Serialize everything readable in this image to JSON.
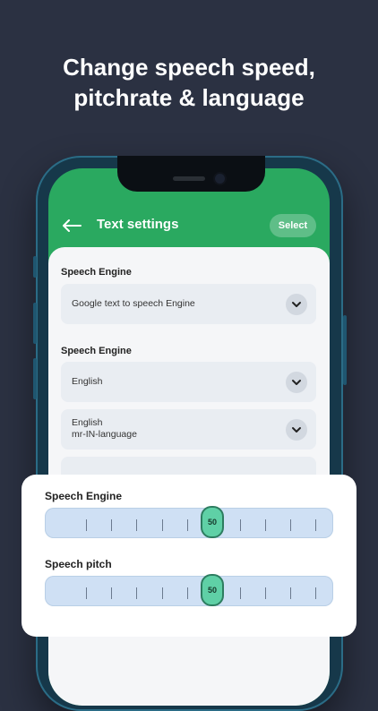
{
  "headline": {
    "line1": "Change speech speed,",
    "line2": "pitchrate & language"
  },
  "app": {
    "title": "Text settings",
    "select_label": "Select",
    "accent_color": "#2aa960",
    "back_icon": "arrow-left-icon"
  },
  "settings": {
    "section1_label": "Speech Engine",
    "engine_value": "Google text to speech Engine",
    "section2_label": "Speech Engine",
    "language_value": "English",
    "voice_value_line1": "English",
    "voice_value_line2": "mr-IN-language"
  },
  "card": {
    "rate_label": "Speech Engine",
    "rate_value": "50",
    "pitch_label": "Speech pitch",
    "pitch_value": "50"
  }
}
